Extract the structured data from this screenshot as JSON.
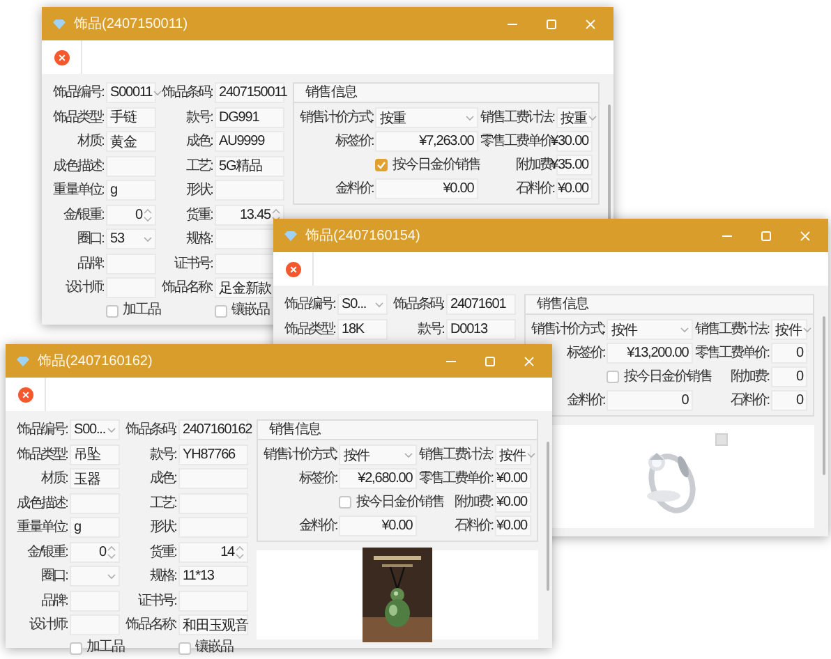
{
  "windows": [
    {
      "title": "饰品(2407150011)",
      "fields": [
        {
          "label": "饰品编号:",
          "value": "S00011",
          "kind": "select"
        },
        {
          "label": "饰品条码:",
          "value": "2407150011",
          "kind": "text"
        },
        {
          "label": "饰品类型:",
          "value": "手链",
          "kind": "text"
        },
        {
          "label": "款号:",
          "value": "DG991",
          "kind": "text"
        },
        {
          "label": "材质:",
          "value": "黄金",
          "kind": "text"
        },
        {
          "label": "成色:",
          "value": "AU9999",
          "kind": "text"
        },
        {
          "label": "成色描述:",
          "kind": "text"
        },
        {
          "label": "工艺:",
          "value": "5G精品",
          "kind": "text"
        },
        {
          "label": "重量单位:",
          "value": "g",
          "kind": "text"
        },
        {
          "label": "形状:",
          "kind": "text"
        },
        {
          "label": "金/银重:",
          "value": "0",
          "kind": "spin"
        },
        {
          "label": "货重:",
          "value": "13.45",
          "kind": "spin"
        },
        {
          "label": "圈口:",
          "value": "53",
          "kind": "select"
        },
        {
          "label": "规格:",
          "kind": "text"
        },
        {
          "label": "品牌:",
          "kind": "text"
        },
        {
          "label": "证书号:",
          "kind": "text"
        },
        {
          "label": "设计师:",
          "kind": "text"
        },
        {
          "label": "饰品名称:",
          "value": "足金新款",
          "kind": "text"
        }
      ],
      "checkboxes": [
        {
          "label": "加工品",
          "checked": false
        },
        {
          "label": "镶嵌品",
          "checked": false
        }
      ],
      "sales": {
        "title": "销售信息",
        "cells": [
          {
            "kind": "select",
            "label": "销售计价方式:",
            "value": "按重"
          },
          {
            "kind": "select",
            "label": "销售工费计法:",
            "value": "按重"
          },
          {
            "kind": "text",
            "label": "标签价:",
            "value": "¥7,263.00"
          },
          {
            "kind": "text",
            "label": "零售工费单价:",
            "value": "¥30.00"
          },
          {
            "kind": "check",
            "label": "按今日金价销售",
            "checked": true
          },
          {
            "kind": "text",
            "label": "附加费:",
            "value": "¥35.00"
          },
          {
            "kind": "text",
            "label": "金料价:",
            "value": "¥0.00"
          },
          {
            "kind": "text",
            "label": "石料价:",
            "value": "¥0.00"
          }
        ]
      }
    },
    {
      "title": "饰品(2407160154)",
      "fields": [
        {
          "label": "饰品编号:",
          "value": "S0...",
          "kind": "select"
        },
        {
          "label": "饰品条码:",
          "value": "24071601",
          "kind": "text"
        },
        {
          "label": "饰品类型:",
          "value": "18K",
          "kind": "text"
        },
        {
          "label": "款号:",
          "value": "D0013",
          "kind": "text"
        }
      ],
      "sales": {
        "title": "销售信息",
        "cells": [
          {
            "kind": "select",
            "label": "销售计价方式:",
            "value": "按件"
          },
          {
            "kind": "select",
            "label": "销售工费计法:",
            "value": "按件"
          },
          {
            "kind": "text",
            "label": "标签价:",
            "value": "¥13,200.00"
          },
          {
            "kind": "text",
            "label": "零售工费单价:",
            "value": "0"
          },
          {
            "kind": "check",
            "label": "按今日金价销售",
            "checked": false
          },
          {
            "kind": "text",
            "label": "附加费:",
            "value": "0"
          },
          {
            "kind": "text",
            "label": "金料价:",
            "value": "0"
          },
          {
            "kind": "text",
            "label": "石料价:",
            "value": "0"
          }
        ]
      },
      "picture": {
        "kind": "picture",
        "image_icon": true
      }
    },
    {
      "title": "饰品(2407160162)",
      "fields": [
        {
          "label": "饰品编号:",
          "value": "S00...",
          "kind": "select"
        },
        {
          "label": "饰品条码:",
          "value": "2407160162",
          "kind": "text"
        },
        {
          "label": "饰品类型:",
          "value": "吊坠",
          "kind": "text"
        },
        {
          "label": "款号:",
          "value": "YH87766",
          "kind": "text"
        },
        {
          "label": "材质:",
          "value": "玉器",
          "kind": "text"
        },
        {
          "label": "成色:",
          "kind": "text"
        },
        {
          "label": "成色描述:",
          "kind": "text"
        },
        {
          "label": "工艺:",
          "kind": "text"
        },
        {
          "label": "重量单位:",
          "value": "g",
          "kind": "text"
        },
        {
          "label": "形状:",
          "kind": "text"
        },
        {
          "label": "金/银重:",
          "value": "0",
          "kind": "spin"
        },
        {
          "label": "货重:",
          "value": "14",
          "kind": "spin"
        },
        {
          "label": "圈口:",
          "kind": "select"
        },
        {
          "label": "规格:",
          "value": "11*13",
          "kind": "text"
        },
        {
          "label": "品牌:",
          "kind": "text"
        },
        {
          "label": "证书号:",
          "kind": "text"
        },
        {
          "label": "设计师:",
          "kind": "text"
        },
        {
          "label": "饰品名称:",
          "value": "和田玉观音",
          "kind": "text"
        }
      ],
      "checkboxes": [
        {
          "label": "加工品",
          "checked": false
        },
        {
          "label": "镶嵌品",
          "checked": false
        }
      ],
      "sales": {
        "title": "销售信息",
        "cells": [
          {
            "kind": "select",
            "label": "销售计价方式:",
            "value": "按件"
          },
          {
            "kind": "select",
            "label": "销售工费计法:",
            "value": "按件"
          },
          {
            "kind": "text",
            "label": "标签价:",
            "value": "¥2,680.00"
          },
          {
            "kind": "text",
            "label": "零售工费单价:",
            "value": "¥0.00"
          },
          {
            "kind": "check",
            "label": "按今日金价销售",
            "checked": false
          },
          {
            "kind": "text",
            "label": "附加费:",
            "value": "¥0.00"
          },
          {
            "kind": "text",
            "label": "金料价:",
            "value": "¥0.00"
          },
          {
            "kind": "text",
            "label": "石料价:",
            "value": "¥0.00"
          }
        ]
      },
      "picture": {
        "kind": "picture"
      }
    }
  ]
}
